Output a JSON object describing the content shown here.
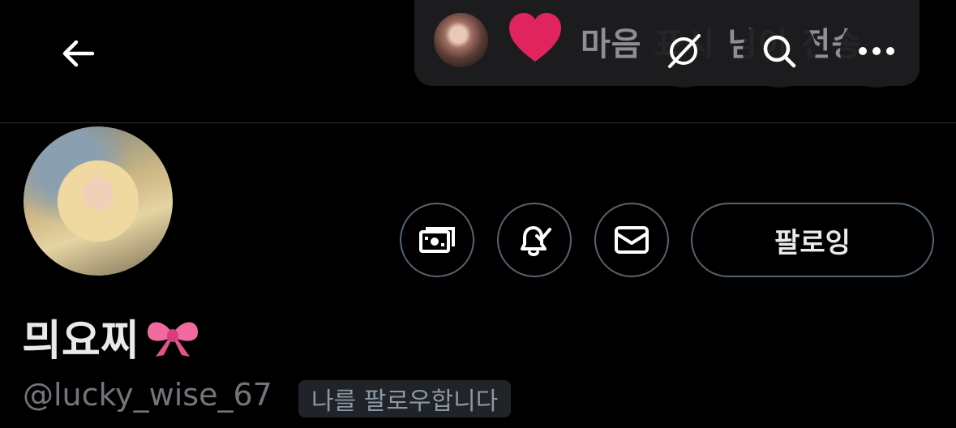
{
  "toast": {
    "message": "마음 표시 님이 전송"
  },
  "profile": {
    "display_name": "믜요찌",
    "handle": "@lucky_wise_67",
    "follows_you": "나를 팔로우합니다",
    "follow_button": "팔로잉"
  },
  "icons": {
    "back": "arrow-left-icon",
    "grok": "grok-icon",
    "search": "search-icon",
    "more": "more-icon",
    "tip": "money-icon",
    "notify": "bell-check-icon",
    "message": "envelope-icon",
    "bow": "ribbon-emoji"
  },
  "colors": {
    "background": "#000000",
    "heart": "#e0245e",
    "text_primary": "#e7e9ea",
    "text_secondary": "#71767b",
    "border": "#536471"
  }
}
